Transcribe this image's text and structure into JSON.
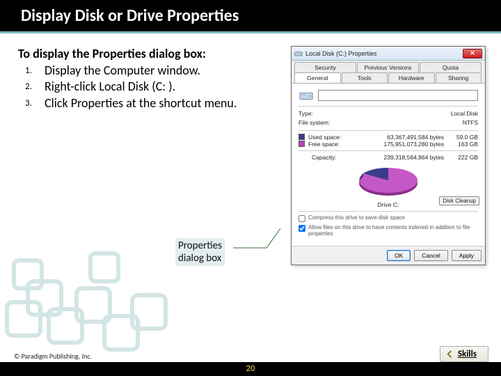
{
  "slide": {
    "title": "Display Disk or Drive Properties",
    "intro": "To display the Properties dialog box:",
    "steps": [
      "Display the Computer window.",
      "Right-click Local Disk (C: ).",
      "Click Properties at the shortcut menu."
    ],
    "callout_label": "Properties\ndialog box",
    "copyright": "© Paradigm Publishing, Inc.",
    "page_number": "20",
    "skills_label": "Skills"
  },
  "dialog": {
    "title": "Local Disk (C:) Properties",
    "tabs_row1": [
      "Security",
      "Previous Versions",
      "Quota"
    ],
    "tabs_row2": [
      "General",
      "Tools",
      "Hardware",
      "Sharing"
    ],
    "active_tab": "General",
    "type_label": "Type:",
    "type_value": "Local Disk",
    "fs_label": "File system:",
    "fs_value": "NTFS",
    "used_label": "Used space:",
    "used_bytes": "63,367,491,584 bytes",
    "used_gb": "59.0 GB",
    "free_label": "Free space:",
    "free_bytes": "175,951,073,280 bytes",
    "free_gb": "163 GB",
    "capacity_label": "Capacity:",
    "capacity_bytes": "239,318,564,864 bytes",
    "capacity_gb": "222 GB",
    "drive_caption": "Drive C:",
    "disk_cleanup": "Disk Cleanup",
    "chk_compress": "Compress this drive to save disk space",
    "chk_index": "Allow files on this drive to have contents indexed in addition to file properties",
    "btn_ok": "OK",
    "btn_cancel": "Cancel",
    "btn_apply": "Apply"
  },
  "chart_data": {
    "type": "pie",
    "title": "Drive C: usage",
    "series": [
      {
        "name": "Used space",
        "value": 59.0,
        "unit": "GB",
        "color": "#3c3c8c"
      },
      {
        "name": "Free space",
        "value": 163,
        "unit": "GB",
        "color": "#b346b3"
      }
    ]
  }
}
